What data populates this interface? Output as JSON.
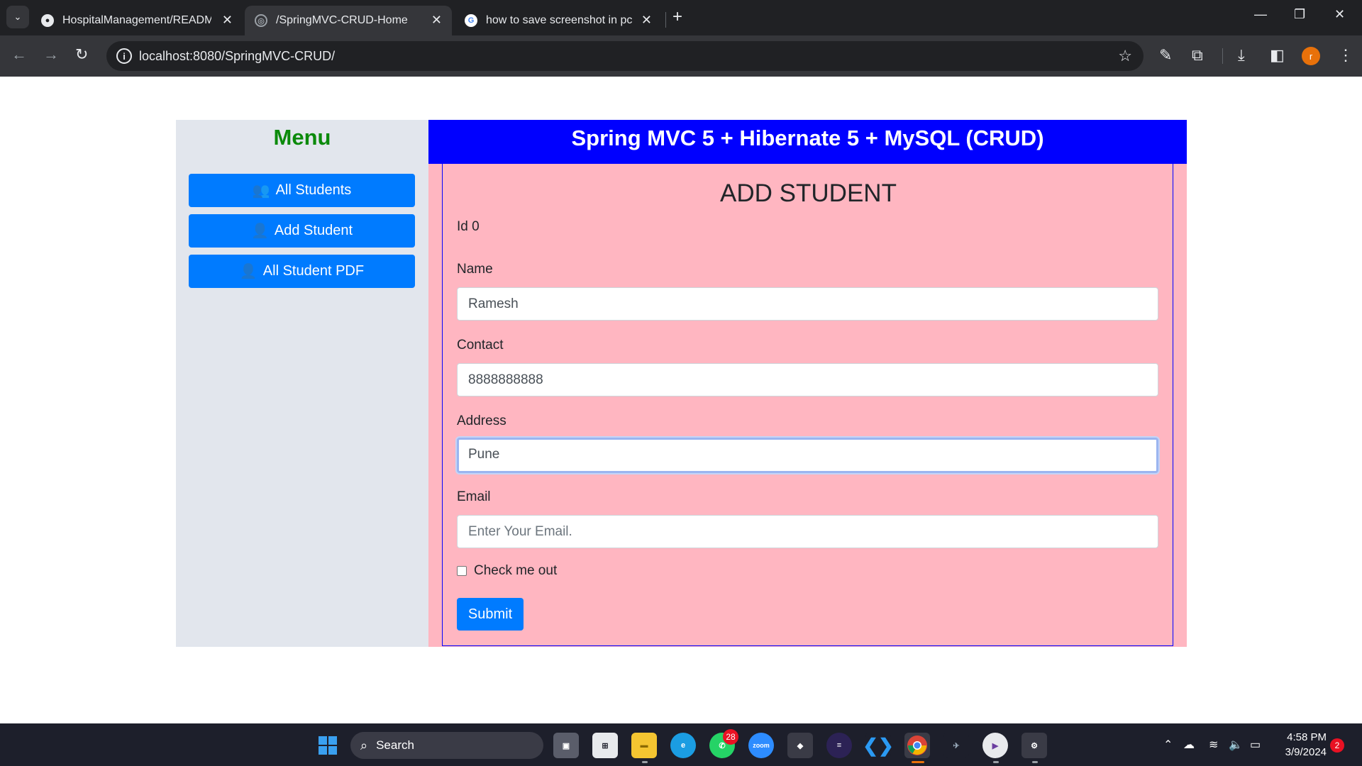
{
  "browser": {
    "tabs": [
      {
        "title": "HospitalManagement/README",
        "icon": "github-icon"
      },
      {
        "title": "/SpringMVC-CRUD-Home",
        "icon": "globe-icon"
      },
      {
        "title": "how to save screenshot in pc di",
        "icon": "google-icon"
      }
    ],
    "active_tab": 1,
    "url": "localhost:8080/SpringMVC-CRUD/",
    "profile_initial": "r"
  },
  "sidebar": {
    "title": "Menu",
    "items": [
      {
        "label": "All Students",
        "icon": "users-icon"
      },
      {
        "label": "Add Student",
        "icon": "user-plus-icon"
      },
      {
        "label": "All Student PDF",
        "icon": "user-plus-icon"
      }
    ]
  },
  "header": {
    "title": "Spring MVC 5 + Hibernate 5 + MySQL (CRUD)"
  },
  "form": {
    "title": "ADD STUDENT",
    "id_text": "Id 0",
    "name": {
      "label": "Name",
      "value": "Ramesh"
    },
    "contact": {
      "label": "Contact",
      "value": "8888888888"
    },
    "address": {
      "label": "Address",
      "value": "Pune"
    },
    "email": {
      "label": "Email",
      "value": "",
      "placeholder": "Enter Your Email."
    },
    "checkbox_label": "Check me out",
    "checkbox_checked": false,
    "submit_label": "Submit"
  },
  "taskbar": {
    "search_label": "Search",
    "whatsapp_badge": "28",
    "zoom_label": "zoom",
    "time": "4:58 PM",
    "date": "3/9/2024",
    "notifications": "2"
  },
  "colors": {
    "menu_title": "#0b8a0b",
    "header_bg": "#0000ff",
    "main_bg": "#ffb6c1",
    "button_bg": "#007bff"
  }
}
